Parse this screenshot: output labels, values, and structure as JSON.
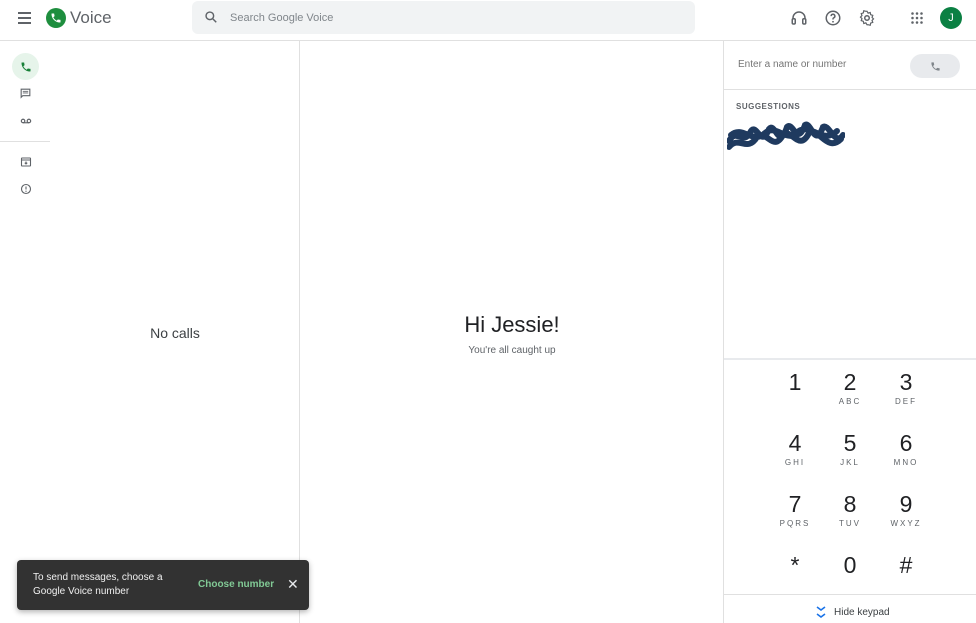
{
  "app": {
    "name": "Voice"
  },
  "search": {
    "placeholder": "Search Google Voice"
  },
  "user": {
    "initial": "J",
    "avatar_color": "#0b8043"
  },
  "nav": {
    "items": [
      "calls",
      "messages",
      "voicemail",
      "archive",
      "spam"
    ],
    "active": "calls"
  },
  "list": {
    "empty_text": "No calls"
  },
  "main": {
    "greeting": "Hi Jessie!",
    "subtitle": "You're all caught up"
  },
  "dialer": {
    "input_placeholder": "Enter a name or number",
    "suggestions_label": "SUGGESTIONS",
    "keys": [
      {
        "digit": "1",
        "letters": ""
      },
      {
        "digit": "2",
        "letters": "ABC"
      },
      {
        "digit": "3",
        "letters": "DEF"
      },
      {
        "digit": "4",
        "letters": "GHI"
      },
      {
        "digit": "5",
        "letters": "JKL"
      },
      {
        "digit": "6",
        "letters": "MNO"
      },
      {
        "digit": "7",
        "letters": "PQRS"
      },
      {
        "digit": "8",
        "letters": "TUV"
      },
      {
        "digit": "9",
        "letters": "WXYZ"
      },
      {
        "digit": "*",
        "letters": ""
      },
      {
        "digit": "0",
        "letters": ""
      },
      {
        "digit": "#",
        "letters": ""
      }
    ],
    "hide_keypad_label": "Hide keypad"
  },
  "snackbar": {
    "message": "To send messages, choose a Google Voice number",
    "action_label": "Choose number",
    "close_symbol": "✕"
  },
  "colors": {
    "accent": "#1e8e3e",
    "active_nav_bg": "#e6f4ea",
    "snackbar_bg": "#323232",
    "snackbar_action": "#81c995"
  }
}
